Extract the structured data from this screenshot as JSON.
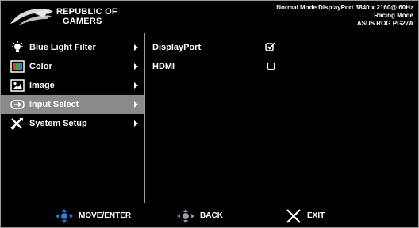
{
  "header": {
    "brand_line1": "REPUBLIC OF",
    "brand_line2": "GAMERS",
    "status_line1": "Normal Mode DisplayPort 3840 x 2160@ 60Hz",
    "status_line2": "Racing Mode",
    "status_line3": "ASUS ROG PG27A"
  },
  "menu": {
    "items": [
      {
        "label": "Blue Light Filter",
        "icon": "blue-light-filter-icon"
      },
      {
        "label": "Color",
        "icon": "color-icon"
      },
      {
        "label": "Image",
        "icon": "image-icon"
      },
      {
        "label": "Input Select",
        "icon": "input-select-icon",
        "selected": true
      },
      {
        "label": "System Setup",
        "icon": "system-setup-icon"
      }
    ]
  },
  "options": {
    "items": [
      {
        "label": "DisplayPort",
        "checked": true
      },
      {
        "label": "HDMI",
        "checked": false
      }
    ]
  },
  "footer": {
    "move_label": "MOVE/ENTER",
    "back_label": "BACK",
    "exit_label": "EXIT"
  },
  "colors": {
    "background": "#000000",
    "selected": "#8a8a8a",
    "joystick": "#2d7fd6",
    "border": "#9a9a9a"
  }
}
